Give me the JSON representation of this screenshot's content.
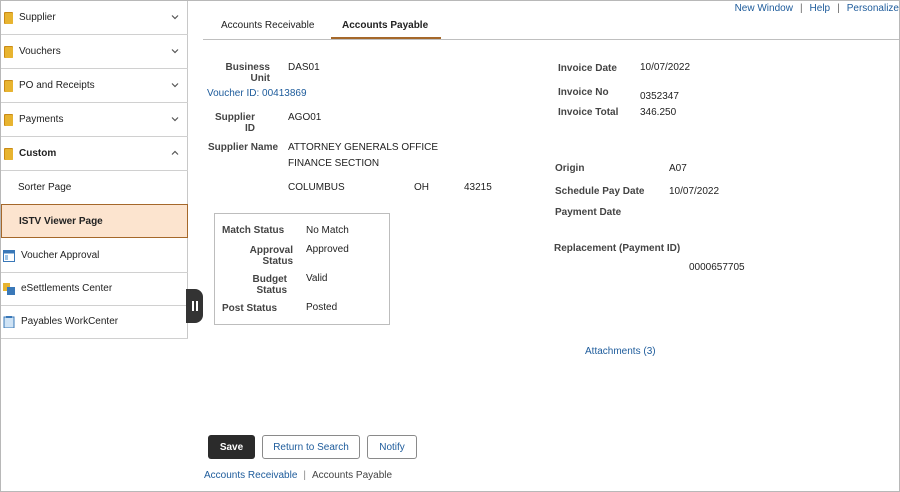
{
  "top_links": {
    "new_window": "New Window",
    "help": "Help",
    "personalize": "Personalize"
  },
  "sidebar": {
    "items": [
      {
        "label": "Supplier",
        "icon": "folder-icon",
        "state": "collapsed"
      },
      {
        "label": "Vouchers",
        "icon": "folder-icon",
        "state": "collapsed"
      },
      {
        "label": "PO and Receipts",
        "icon": "folder-icon",
        "state": "collapsed"
      },
      {
        "label": "Payments",
        "icon": "folder-icon",
        "state": "collapsed"
      },
      {
        "label": "Custom",
        "icon": "folder-icon",
        "state": "expanded"
      },
      {
        "label": "Sorter Page"
      },
      {
        "label": "ISTV Viewer Page",
        "active": true
      },
      {
        "label": "Voucher Approval",
        "icon": "window-icon"
      },
      {
        "label": "eSettlements Center",
        "icon": "settlements-icon"
      },
      {
        "label": "Payables WorkCenter",
        "icon": "workcenter-icon"
      }
    ]
  },
  "tabs": [
    {
      "label": "Accounts Receivable",
      "active": false
    },
    {
      "label": "Accounts Payable",
      "active": true
    }
  ],
  "form": {
    "business_unit_label_1": "Business",
    "business_unit_label_2": "Unit",
    "business_unit": "DAS01",
    "voucher_link": "Voucher ID: 00413869",
    "supplier_id_label_1": "Supplier",
    "supplier_id_label_2": "ID",
    "supplier_id": "AGO01",
    "supplier_name_label": "Supplier Name",
    "supplier_name_1": "ATTORNEY GENERALS OFFICE",
    "supplier_name_2": "FINANCE SECTION",
    "city": "COLUMBUS",
    "state": "OH",
    "zip": "43215",
    "invoice_date_label": "Invoice Date",
    "invoice_date": "10/07/2022",
    "invoice_no_label": "Invoice No",
    "invoice_no": "0352347",
    "invoice_total_label": "Invoice Total",
    "invoice_total": "346.250",
    "origin_label": "Origin",
    "origin": "A07",
    "schedule_pay_date_label": "Schedule Pay Date",
    "schedule_pay_date": "10/07/2022",
    "payment_date_label": "Payment Date",
    "replacement_label": "Replacement (Payment ID)",
    "replacement": "0000657705",
    "attachments": "Attachments (3)"
  },
  "status": {
    "match_label": "Match Status",
    "match": "No Match",
    "approval_label_1": "Approval",
    "approval_label_2": "Status",
    "approval": "Approved",
    "budget_label_1": "Budget",
    "budget_label_2": "Status",
    "budget": "Valid",
    "post_label": "Post Status",
    "post": "Posted"
  },
  "buttons": {
    "save": "Save",
    "return": "Return to Search",
    "notify": "Notify"
  },
  "bottom_links": {
    "ar": "Accounts Receivable",
    "ap": "Accounts Payable"
  },
  "colors": {
    "accent": "#a5682a",
    "active_bg": "#fce4cf",
    "link": "#1d5b9b",
    "primary_btn": "#2b2b2b"
  }
}
